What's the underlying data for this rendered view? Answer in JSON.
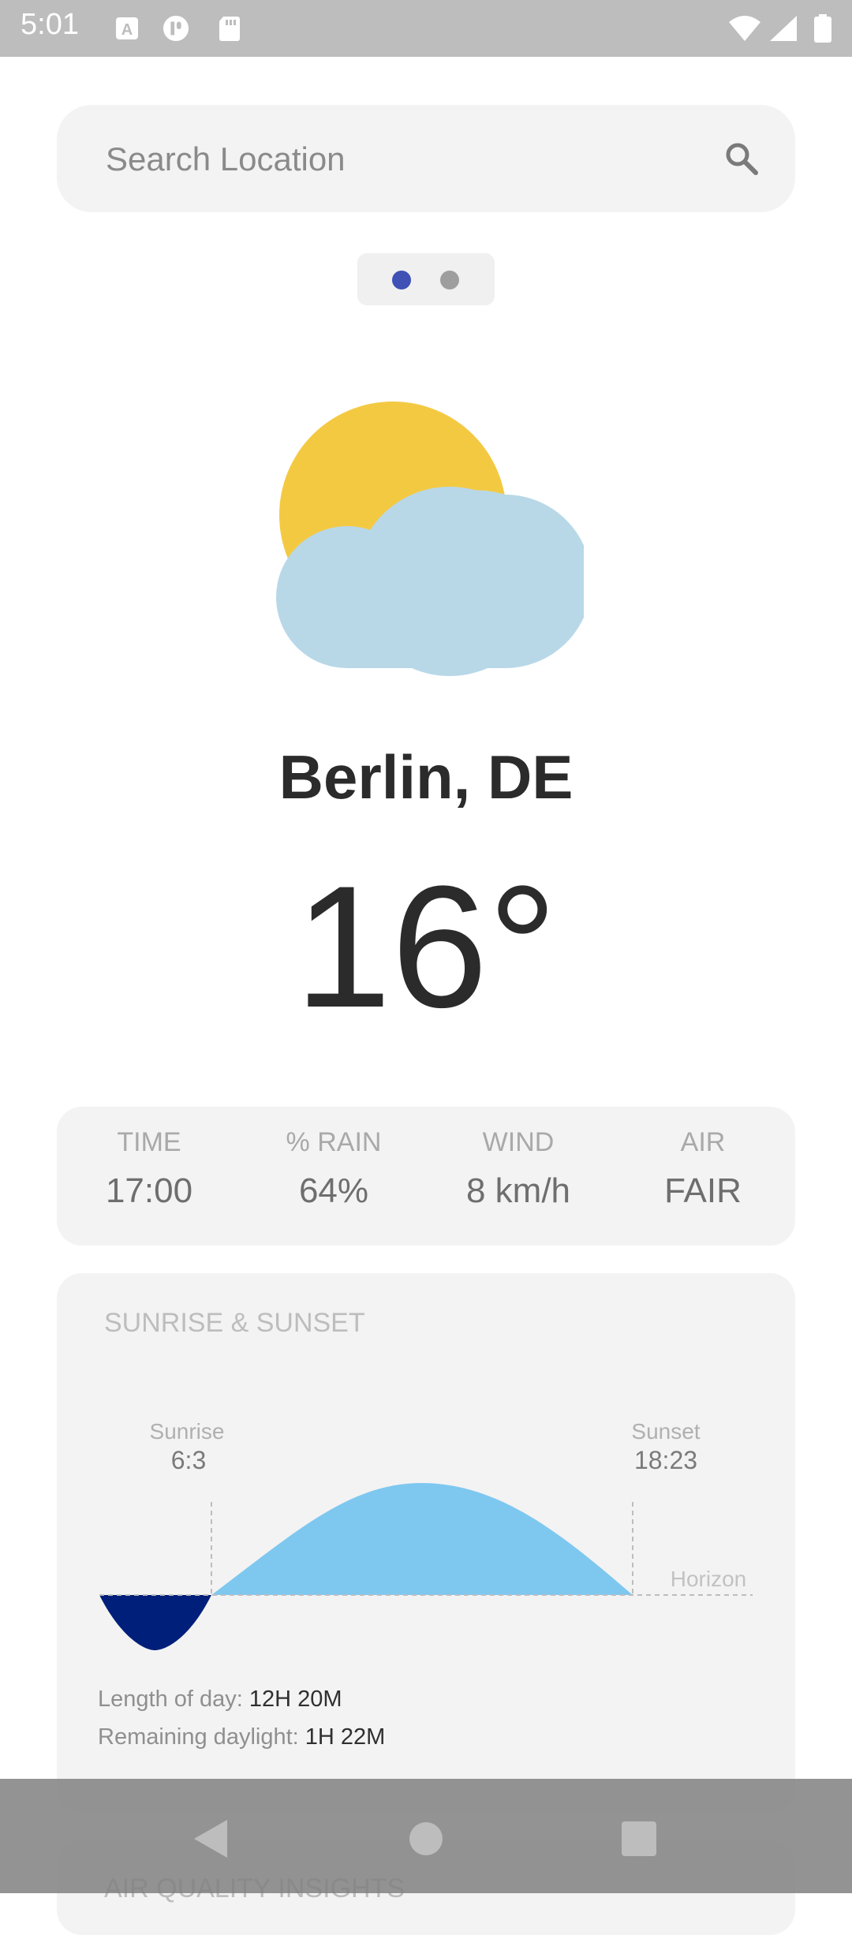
{
  "status_bar": {
    "time": "5:01",
    "left_icons": [
      "font-a-icon",
      "app-circle-icon",
      "sd-card-icon"
    ],
    "right_icons": [
      "wifi-icon",
      "signal-icon",
      "battery-icon"
    ]
  },
  "search": {
    "placeholder": "Search Location",
    "icon": "search-icon"
  },
  "pager": {
    "count": 2,
    "active_index": 0,
    "active_color": "#3f51b5",
    "inactive_color": "#9e9e9e"
  },
  "weather": {
    "icon": "partly-cloudy-icon",
    "sun_color": "#f4c942",
    "cloud_color": "#b8d8e8",
    "city": "Berlin, DE",
    "temperature": "16°"
  },
  "stats": [
    {
      "label": "TIME",
      "value": "17:00"
    },
    {
      "label": "% RAIN",
      "value": "64%"
    },
    {
      "label": "WIND",
      "value": "8 km/h"
    },
    {
      "label": "AIR",
      "value": "FAIR"
    }
  ],
  "sun_card": {
    "title": "SUNRISE & SUNSET",
    "sunrise_label": "Sunrise",
    "sunrise_time": "6:3",
    "sunset_label": "Sunset",
    "sunset_time": "18:23",
    "horizon_label": "Horizon",
    "day_color": "#7ec8f0",
    "night_color": "#001f7a",
    "length_label": "Length of day:",
    "length_value": "12H 20M",
    "remaining_label": "Remaining daylight:",
    "remaining_value": "1H 22M"
  },
  "next_card": {
    "title": "AIR QUALITY INSIGHTS"
  },
  "nav_bar": {
    "buttons": [
      "back-icon",
      "home-icon",
      "recents-icon"
    ]
  }
}
